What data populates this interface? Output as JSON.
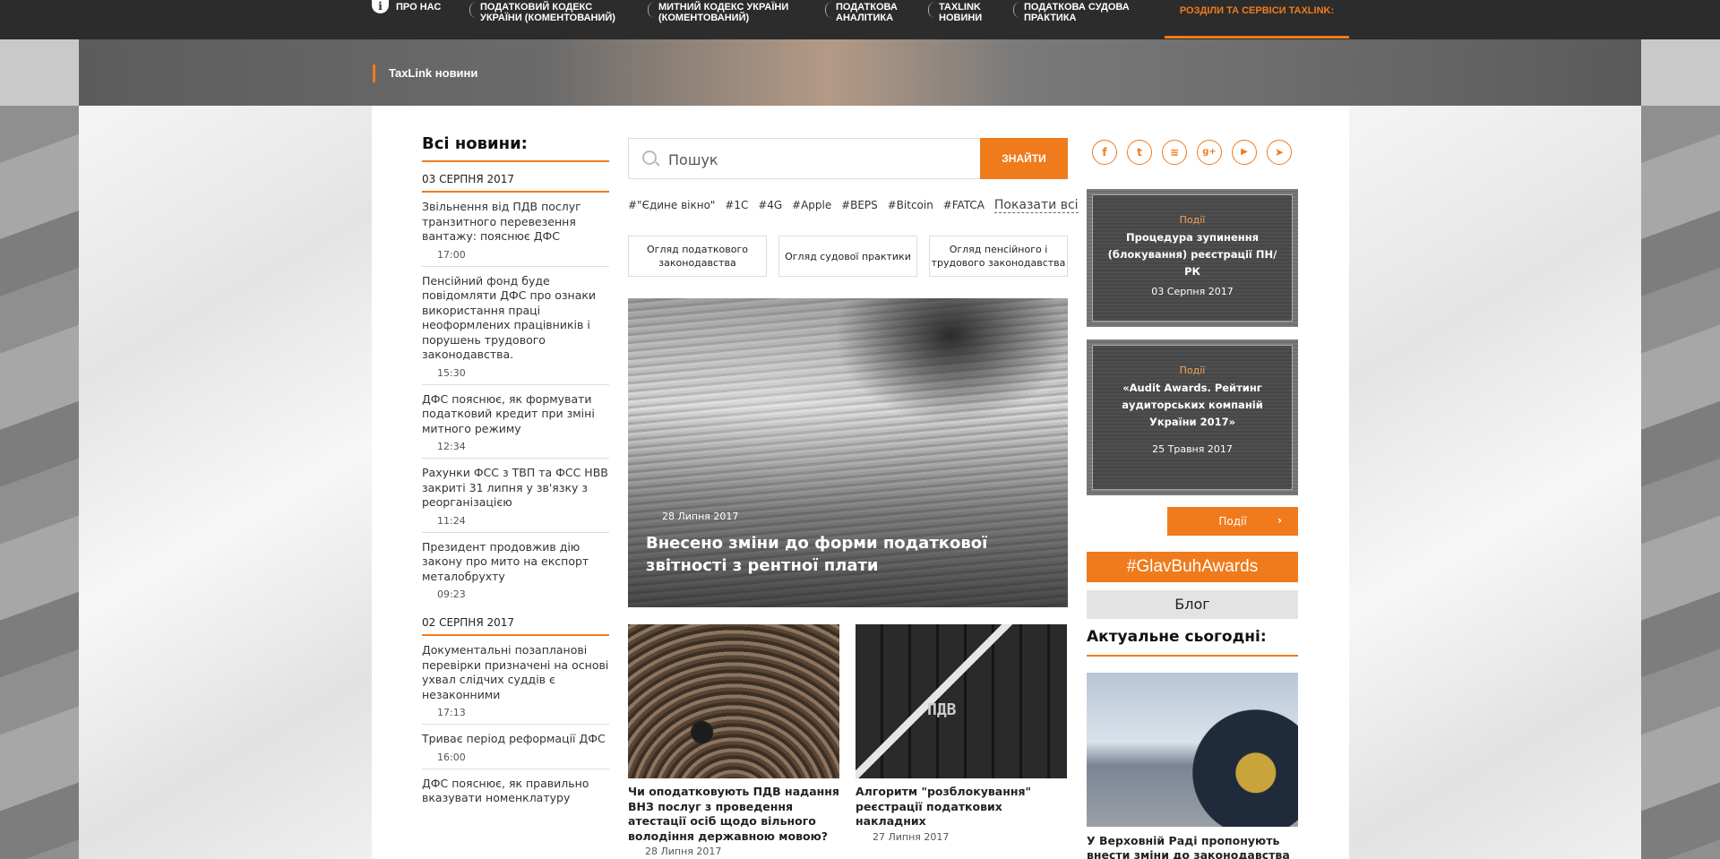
{
  "topnav": {
    "items": [
      {
        "label": "ПРО НАС"
      },
      {
        "label": "ПОДАТКОВИЙ КОДЕКС УКРАЇНИ (КОМЕНТОВАНИЙ)"
      },
      {
        "label": "МИТНИЙ КОДЕКС УКРАЇНИ (КОМЕНТОВАНИЙ)"
      },
      {
        "label": "ПОДАТКОВА АНАЛІТИКА"
      },
      {
        "label": "TAXLINK НОВИНИ"
      },
      {
        "label": "ПОДАТКОВА СУДОВА ПРАКТИКА"
      }
    ],
    "sections": "РОЗДІЛИ ТА СЕРВІСИ TAXLINK:"
  },
  "banner": {
    "title": "TaxLink новини"
  },
  "news": {
    "heading": "Всі новини:",
    "groups": [
      {
        "date": "03 СЕРПНЯ 2017",
        "items": [
          {
            "title": "Звільнення від ПДВ послуг транзитного перевезення вантажу: пояснює ДФС",
            "time": "17:00"
          },
          {
            "title": "Пенсійний фонд буде повідомляти ДФС про ознаки використання праці неоформлених працівників і порушень трудового законодавства.",
            "time": "15:30"
          },
          {
            "title": "ДФС пояснює, як формувати податковий кредит при зміні митного режиму",
            "time": "12:34"
          },
          {
            "title": "Рахунки ФСС з ТВП та ФСС НВВ закриті 31 липня у зв'язку з реорганізацією",
            "time": "11:24"
          },
          {
            "title": "Президент продовжив дію закону про мито на експорт металобрухту",
            "time": "09:23"
          }
        ]
      },
      {
        "date": "02 СЕРПНЯ 2017",
        "items": [
          {
            "title": "Документальні позапланові перевірки призначені на основі ухвал слідчих суддів є незаконними",
            "time": "17:13"
          },
          {
            "title": "Триває період реформації ДФС",
            "time": "16:00"
          },
          {
            "title": "ДФС пояснює, як правильно вказувати номенклатуру",
            "time": ""
          }
        ]
      }
    ]
  },
  "search": {
    "placeholder": "Пошук",
    "button": "ЗНАЙТИ"
  },
  "tags": [
    "#\"Єдине вікно\"",
    "#1С",
    "#4G",
    "#Apple",
    "#BEPS",
    "#Bitcoin",
    "#FATCA"
  ],
  "tags_more": "Показати всі",
  "categories": [
    "Огляд податкового законодавства",
    "Огляд судової практики",
    "Огляд пенсійного і трудового законодавства"
  ],
  "hero": {
    "date": "28 Липня 2017",
    "title": "Внесено зміни до форми податкової звітності з рентної плати"
  },
  "cards": [
    {
      "title": "Чи оподатковують ПДВ надання ВНЗ послуг з проведення атестації осіб щодо вільного володіння державною мовою?",
      "date": "28 Липня 2017"
    },
    {
      "title": "Алгоритм \"розблокування\" реєстрації податкових накладних",
      "date": "27 Липня 2017",
      "image_text": "ПДВ"
    }
  ],
  "socials": [
    {
      "icon": "facebook-icon",
      "glyph": "f"
    },
    {
      "icon": "twitter-icon",
      "glyph": "t"
    },
    {
      "icon": "rss-icon",
      "glyph": "≋"
    },
    {
      "icon": "google-plus-icon",
      "glyph": "g+"
    },
    {
      "icon": "youtube-icon",
      "glyph": "▶"
    },
    {
      "icon": "telegram-icon",
      "glyph": "➤"
    }
  ],
  "events": [
    {
      "label": "Події",
      "title": "Процедура зупинення (блокування) реєстрації ПН/РК",
      "date": "03 Серпня 2017"
    },
    {
      "label": "Події",
      "title": "«Audit Awards. Рейтинг аудиторських компаній України 2017»",
      "date": "25 Травня 2017"
    }
  ],
  "events_button": "Події",
  "glavbuh": "#GlavBuhAwards",
  "blog": "Блог",
  "actual": {
    "heading": "Актуальне сьогодні:",
    "title": "У Верховній Раді пропонують внести зміни до законодавства з"
  },
  "colors": {
    "accent": "#f07b1c",
    "nav_bg": "#2c2c2c"
  }
}
